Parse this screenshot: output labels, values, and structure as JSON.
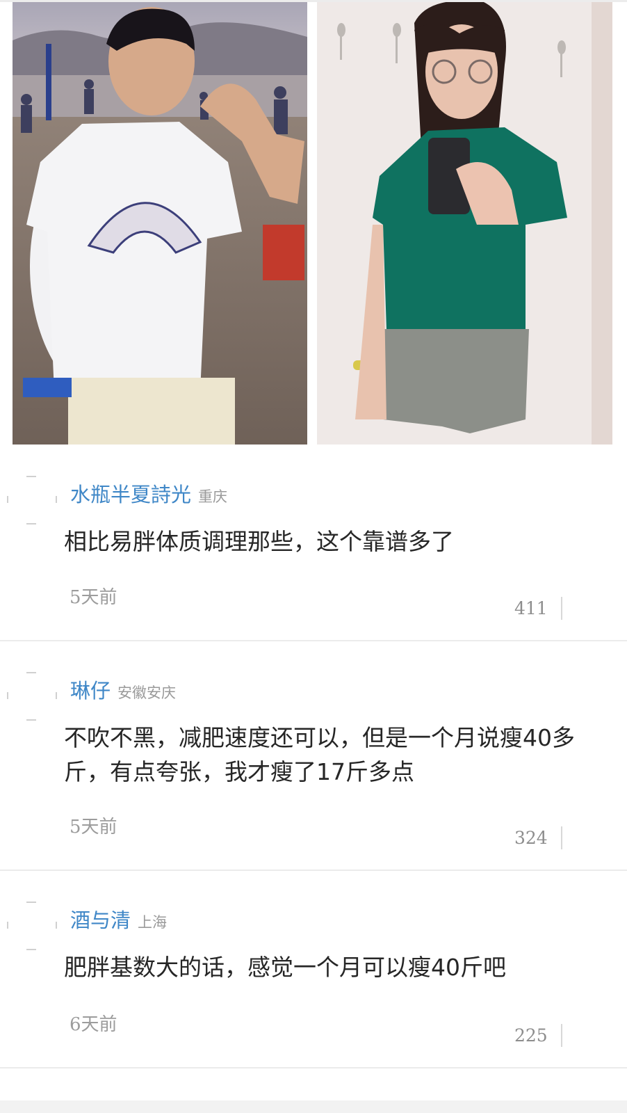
{
  "images": [
    {
      "name": "before-photo",
      "icon": "woman-white-tshirt-beach-photo"
    },
    {
      "name": "after-photo",
      "icon": "woman-green-tshirt-mirror-selfie-photo"
    }
  ],
  "comments": [
    {
      "author": "水瓶半夏詩光",
      "location": "重庆",
      "text": "相比易胖体质调理那些，这个靠谱多了",
      "time": "5天前",
      "likes": "411"
    },
    {
      "author": "琳仔",
      "location": "安徽安庆",
      "text": "不吹不黑，减肥速度还可以，但是一个月说瘦40多斤，有点夸张，我才瘦了17斤多点",
      "time": "5天前",
      "likes": "324"
    },
    {
      "author": "酒与清",
      "location": "上海",
      "text": "肥胖基数大的话，感觉一个月可以瘦40斤吧",
      "time": "6天前",
      "likes": "225"
    }
  ],
  "colors": {
    "author": "#3f87c7",
    "text": "#262626",
    "meta": "#9a9a9a",
    "divider": "#ebebeb"
  }
}
